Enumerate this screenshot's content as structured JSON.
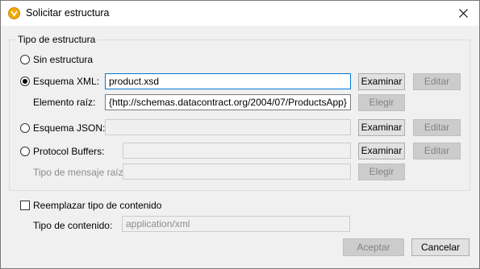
{
  "window": {
    "title": "Solicitar estructura"
  },
  "group": {
    "legend": "Tipo de estructura"
  },
  "options": {
    "none": {
      "label": "Sin estructura",
      "selected": false
    },
    "xml": {
      "label": "Esquema XML:",
      "selected": true,
      "value": "product.xsd",
      "browse_label": "Examinar",
      "edit_label": "Editar",
      "root_element_label": "Elemento raíz:",
      "root_element_value": "{http://schemas.datacontract.org/2004/07/ProductsApp}",
      "choose_label": "Elegir"
    },
    "json": {
      "label": "Esquema JSON:",
      "selected": false,
      "value": "",
      "browse_label": "Examinar",
      "edit_label": "Editar"
    },
    "protobuf": {
      "label": "Protocol Buffers:",
      "selected": false,
      "value": "",
      "browse_label": "Examinar",
      "edit_label": "Editar",
      "root_message_label": "Tipo de mensaje raíz:",
      "root_message_value": "",
      "choose_label": "Elegir"
    }
  },
  "content_type": {
    "override_label": "Reemplazar tipo de contenido",
    "override_checked": false,
    "label": "Tipo de contenido:",
    "value": "application/xml"
  },
  "footer": {
    "ok_label": "Aceptar",
    "cancel_label": "Cancelar"
  },
  "colors": {
    "accent": "#0078d7",
    "icon": "#f2a900"
  },
  "icons": {
    "app": "altova-mapforce-icon",
    "close": "close-icon"
  }
}
